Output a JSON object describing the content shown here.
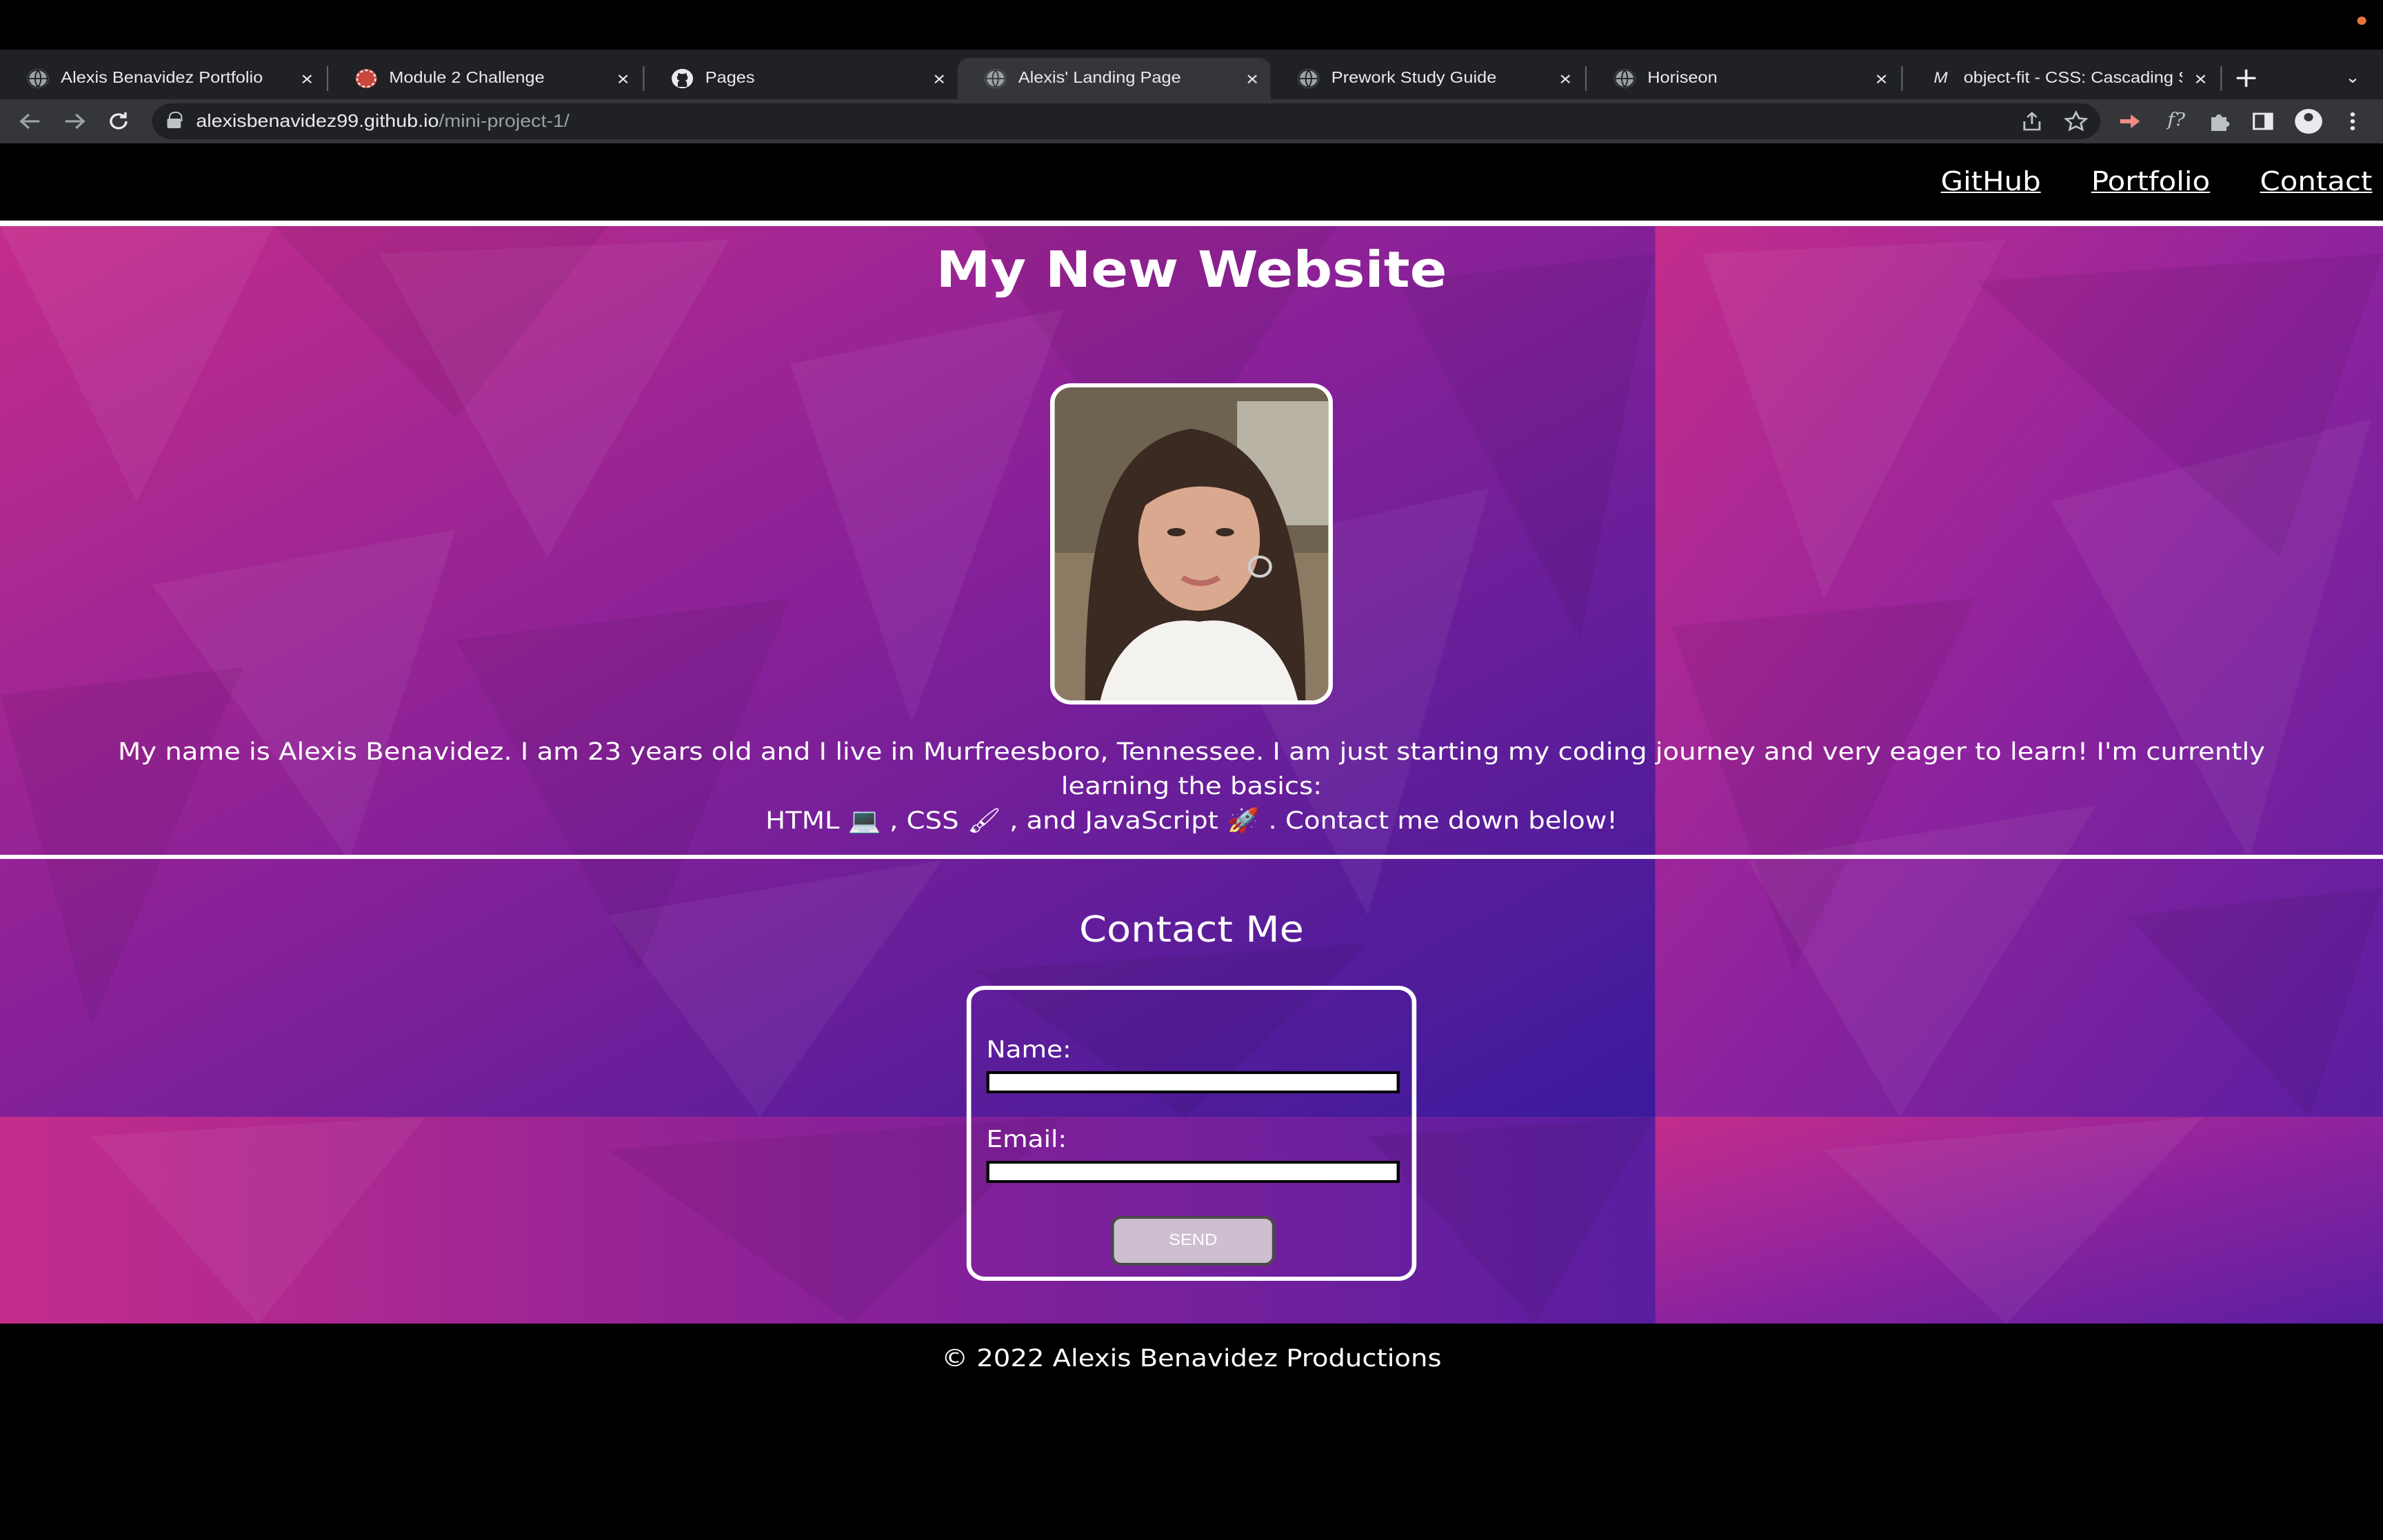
{
  "browser": {
    "tabs": [
      {
        "title": "Alexis Benavidez Portfolio",
        "icon": "globe-icon"
      },
      {
        "title": "Module 2 Challenge",
        "icon": "bootcamp-logo-icon"
      },
      {
        "title": "Pages",
        "icon": "github-icon"
      },
      {
        "title": "Alexis' Landing Page",
        "icon": "globe-icon",
        "active": true
      },
      {
        "title": "Prework Study Guide",
        "icon": "globe-icon"
      },
      {
        "title": "Horiseon",
        "icon": "globe-icon"
      },
      {
        "title": "object-fit - CSS: Cascading S",
        "icon": "mdn-icon"
      }
    ],
    "close_glyph": "×",
    "new_tab_glyph": "+",
    "tab_menu_glyph": "⌄",
    "url_host": "alexisbenavidez99.github.io",
    "url_path": "/mini-project-1/",
    "mdn_icon_text": "M",
    "colors": {
      "record_dot": "#e8743b",
      "chrome_dark": "#202124",
      "chrome_toolbar": "#35363a"
    }
  },
  "site": {
    "nav": {
      "github": "GitHub",
      "portfolio": "Portfolio",
      "contact": "Contact"
    },
    "title": "My New Website",
    "bio_line1": "My name is Alexis Benavidez. I am 23 years old and I live in Murfreesboro, Tennessee. I am just starting my coding journey and very eager to learn! I'm currently learning the basics:",
    "bio_line2_a": "HTML",
    "bio_line2_b": ", CSS",
    "bio_line2_c": ", and JavaScript",
    "bio_line2_d": ". Contact me down below!",
    "emoji_laptop": "💻",
    "emoji_brush": "🖌",
    "emoji_rocket": "🚀",
    "contact_heading": "Contact Me",
    "form": {
      "name_label": "Name:",
      "email_label": "Email:",
      "send_label": "SEND",
      "name_value": "",
      "email_value": ""
    },
    "footer": "© 2022 Alexis Benavidez Productions",
    "colors": {
      "magenta": "#c42d8c",
      "purple": "#7a1fa0",
      "indigo": "#3a1a9c",
      "send_button": "#cdbfcf"
    }
  }
}
